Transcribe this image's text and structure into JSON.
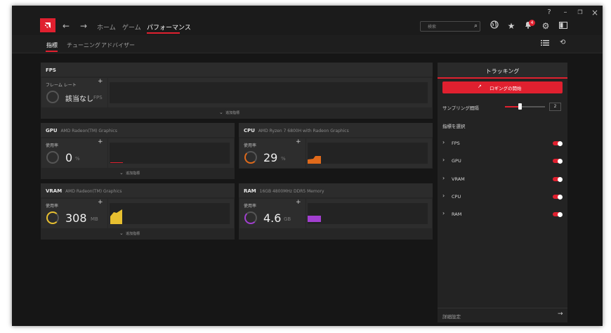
{
  "window": {
    "help": "?",
    "minimize": "–",
    "maximize": "❐",
    "close": "×"
  },
  "nav": {
    "back": "←",
    "forward": "→",
    "home": "ホーム",
    "game": "ゲーム",
    "performance": "パフォーマンス"
  },
  "search": {
    "placeholder": "検索",
    "icon": "search-icon"
  },
  "toolbar": {
    "notification_count": "4",
    "accent": "#e0202f"
  },
  "subnav": {
    "tabs": [
      "指標",
      "チューニング",
      "アドバイザー"
    ]
  },
  "fps": {
    "title": "FPS",
    "card_label": "フレーム レート",
    "value": "該当なし",
    "unit": "FPS",
    "add_metric": "追加指標"
  },
  "gpu": {
    "title": "GPU",
    "subtitle": "AMD Radeon(TM) Graphics",
    "card_label": "使用率",
    "value": "0",
    "unit": "%",
    "ring_color": "#555555",
    "add_metric": "追加指標"
  },
  "cpu": {
    "title": "CPU",
    "subtitle": "AMD Ryzen 7 6800H with Radeon Graphics",
    "card_label": "使用率",
    "value": "29",
    "unit": "%",
    "ring_color": "#e06a1b"
  },
  "vram": {
    "title": "VRAM",
    "subtitle": "AMD Radeon(TM) Graphics",
    "card_label": "使用率",
    "value": "308",
    "unit": "MB",
    "ring_color": "#e8c030",
    "add_metric": "追加指標"
  },
  "ram": {
    "title": "RAM",
    "subtitle": "16GB 4800MHz DDR5 Memory",
    "card_label": "使用率",
    "value": "4.6",
    "unit": "GB",
    "ring_color": "#a23fd0"
  },
  "tracking": {
    "title": "トラッキング",
    "start_button": "ロギングの開始",
    "sampling_label": "サンプリング間隔",
    "sampling_value": "2",
    "select_metrics": "指標を選択",
    "items": [
      "FPS",
      "GPU",
      "VRAM",
      "CPU",
      "RAM"
    ],
    "details": "詳細設定"
  }
}
